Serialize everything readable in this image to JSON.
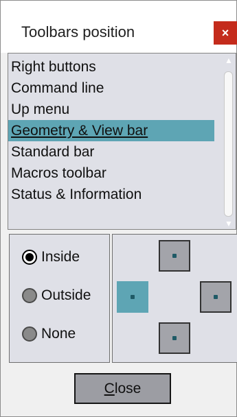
{
  "dialog": {
    "title": "Toolbars position",
    "close_glyph": "×"
  },
  "toolbar_list": {
    "selected_index": 3,
    "items": [
      "Right buttons",
      "Command line",
      "Up menu",
      "Geometry & View bar",
      "Standard bar",
      "Macros toolbar",
      "Status & Information"
    ]
  },
  "placement": {
    "selected": "Inside",
    "options": [
      "Inside",
      "Outside",
      "None"
    ]
  },
  "position": {
    "selected": "left",
    "options": [
      "top",
      "left",
      "right",
      "bottom"
    ]
  },
  "buttons": {
    "close_mnemonic": "C",
    "close_rest": "lose"
  },
  "colors": {
    "selection": "#5ea5b4",
    "title_close": "#c42b1c",
    "panel_bg": "#dfe0e7"
  }
}
